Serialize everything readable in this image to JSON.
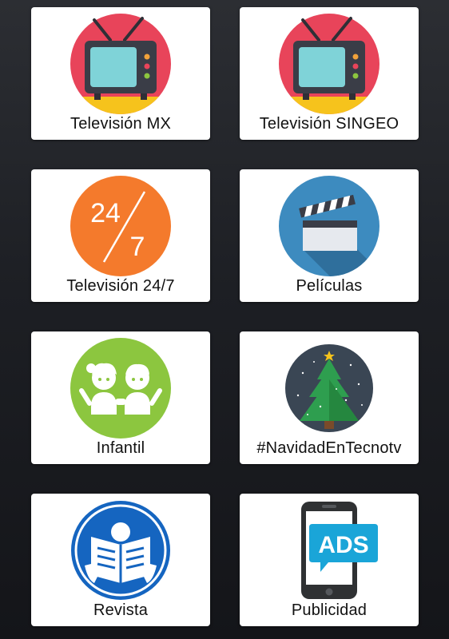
{
  "tiles": [
    {
      "label": "Televisión MX",
      "icon": "tv-icon",
      "color": "#e8445a"
    },
    {
      "label": "Televisión SINGEO",
      "icon": "tv-icon",
      "color": "#e8445a"
    },
    {
      "label": "Televisión 24/7",
      "icon": "24-7-icon",
      "color": "#f47a2c",
      "icon_text_top": "24",
      "icon_text_bottom": "7"
    },
    {
      "label": "Películas",
      "icon": "clapperboard-icon",
      "color": "#3d8bbf"
    },
    {
      "label": "Infantil",
      "icon": "children-icon",
      "color": "#8cc63f"
    },
    {
      "label": "#NavidadEnTecnotv",
      "icon": "christmas-tree-icon",
      "color": "#3a4654"
    },
    {
      "label": "Revista",
      "icon": "magazine-reader-icon",
      "color": "#1565c0"
    },
    {
      "label": "Publicidad",
      "icon": "phone-ads-icon",
      "color": "#1aa5d8",
      "icon_text": "ADS"
    }
  ]
}
